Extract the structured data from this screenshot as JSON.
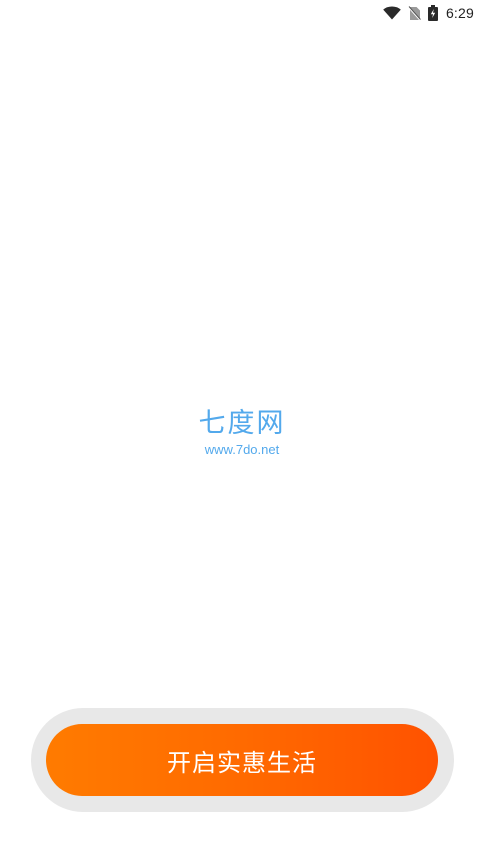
{
  "status_bar": {
    "time": "6:29",
    "icons": [
      "wifi-icon",
      "no-sim-icon",
      "battery-charging-icon"
    ]
  },
  "watermark": {
    "title": "七度网",
    "url": "www.7do.net"
  },
  "cta": {
    "label": "开启实惠生活"
  },
  "colors": {
    "accent_start": "#ff7b00",
    "accent_end": "#ff5200",
    "watermark": "#53a9ec",
    "button_track": "#e8e8e8"
  }
}
